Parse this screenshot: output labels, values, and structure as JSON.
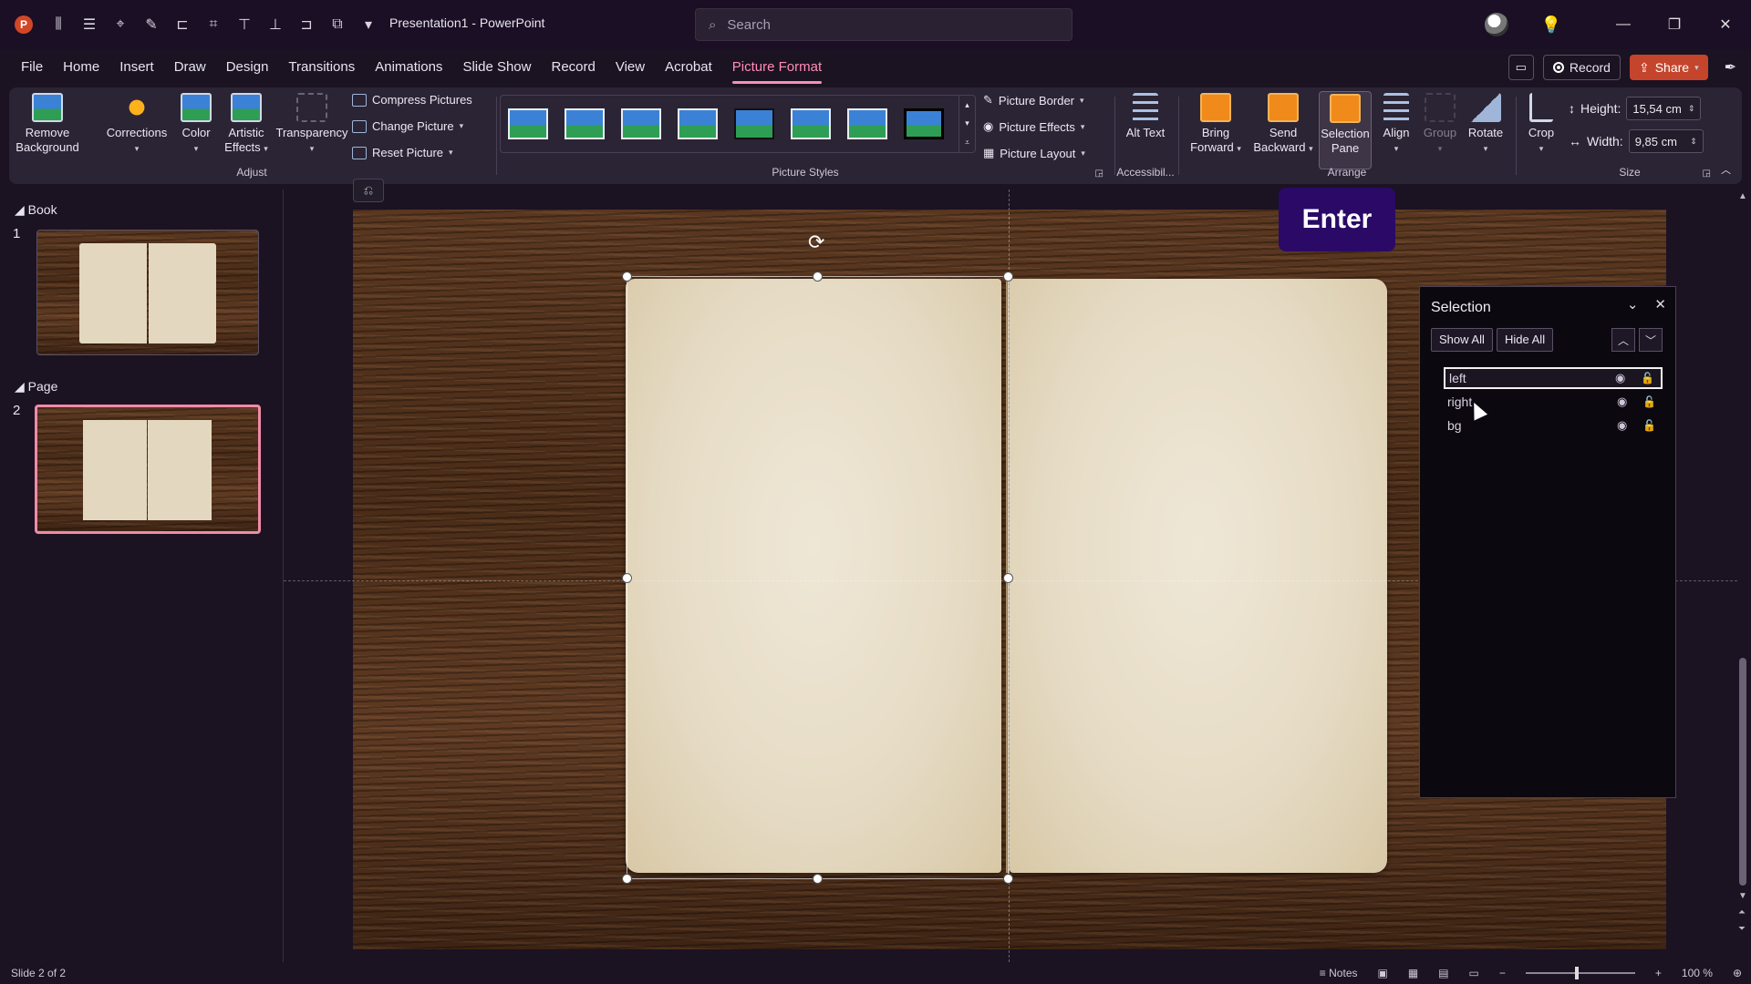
{
  "window": {
    "title": "Presentation1  -  PowerPoint",
    "search_placeholder": "Search",
    "app_icon": "P"
  },
  "tabs": [
    "File",
    "Home",
    "Insert",
    "Draw",
    "Design",
    "Transitions",
    "Animations",
    "Slide Show",
    "Record",
    "View",
    "Acrobat",
    "Picture Format"
  ],
  "active_tab": "Picture Format",
  "tab_actions": {
    "record": "Record",
    "share": "Share"
  },
  "ribbon": {
    "adjust": {
      "label": "Adjust",
      "remove_background": "Remove Background",
      "corrections": "Corrections",
      "color": "Color",
      "artistic_effects": "Artistic Effects",
      "transparency": "Transparency",
      "compress_pictures": "Compress Pictures",
      "change_picture": "Change Picture",
      "reset_picture": "Reset Picture"
    },
    "picture_styles": {
      "label": "Picture Styles",
      "picture_border": "Picture Border",
      "picture_effects": "Picture Effects",
      "picture_layout": "Picture Layout"
    },
    "accessibility": {
      "label": "Accessibil...",
      "alt_text": "Alt Text"
    },
    "arrange": {
      "label": "Arrange",
      "bring_forward": "Bring Forward",
      "send_backward": "Send Backward",
      "selection_pane": "Selection Pane",
      "align": "Align",
      "group": "Group",
      "rotate": "Rotate"
    },
    "size": {
      "label": "Size",
      "crop": "Crop",
      "height_label": "Height:",
      "height_value": "15,54 cm",
      "width_label": "Width:",
      "width_value": "9,85 cm"
    }
  },
  "slides_pane": {
    "sections": [
      {
        "name": "Book",
        "slide_number": "1"
      },
      {
        "name": "Page",
        "slide_number": "2"
      }
    ]
  },
  "overlay": {
    "enter_badge": "Enter"
  },
  "selection_pane": {
    "title": "Selection",
    "show_all": "Show All",
    "hide_all": "Hide All",
    "items": [
      "left",
      "right",
      "bg"
    ],
    "active_item": "left"
  },
  "status": {
    "slide_info": "Slide 2 of 2",
    "notes": "Notes",
    "zoom": "100 %"
  }
}
